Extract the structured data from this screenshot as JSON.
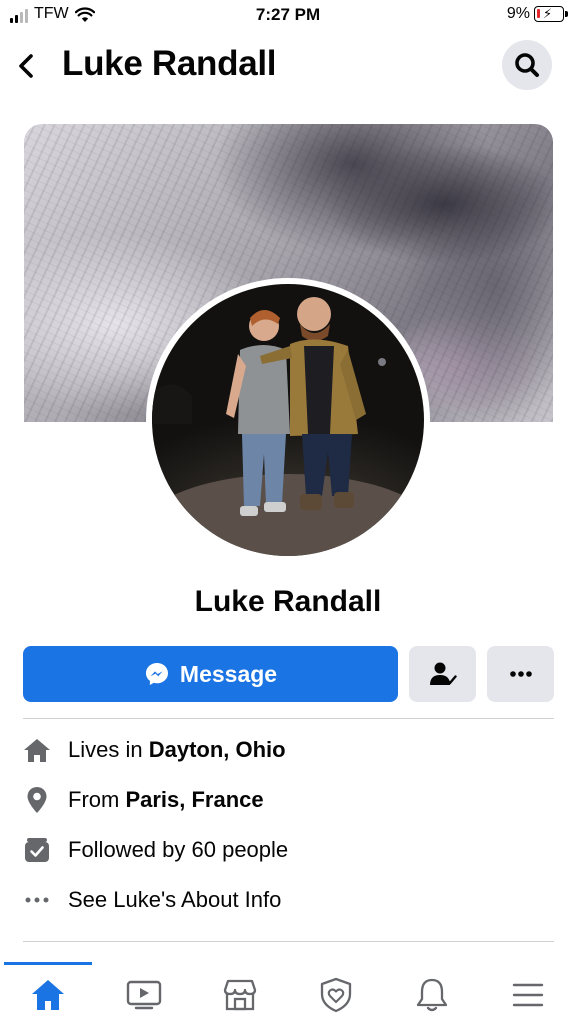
{
  "status_bar": {
    "carrier": "TFW",
    "time": "7:27 PM",
    "battery": "9%"
  },
  "header": {
    "title": "Luke Randall"
  },
  "profile": {
    "name": "Luke Randall"
  },
  "actions": {
    "message_label": "Message"
  },
  "details": {
    "lives_prefix": "Lives in ",
    "lives_value": "Dayton, Ohio",
    "from_prefix": "From ",
    "from_value": "Paris, France",
    "followed_text": "Followed by 60 people",
    "about_text": "See Luke's About Info"
  },
  "tabs": [
    {
      "icon": "home-icon",
      "active": true
    },
    {
      "icon": "video-icon"
    },
    {
      "icon": "marketplace-icon"
    },
    {
      "icon": "shield-heart-icon"
    },
    {
      "icon": "bell-icon"
    },
    {
      "icon": "menu-icon"
    }
  ],
  "colors": {
    "accent": "#1b74e4",
    "secondary_button": "#e4e6eb",
    "divider": "#ced0d4",
    "icon": "#65676b"
  }
}
